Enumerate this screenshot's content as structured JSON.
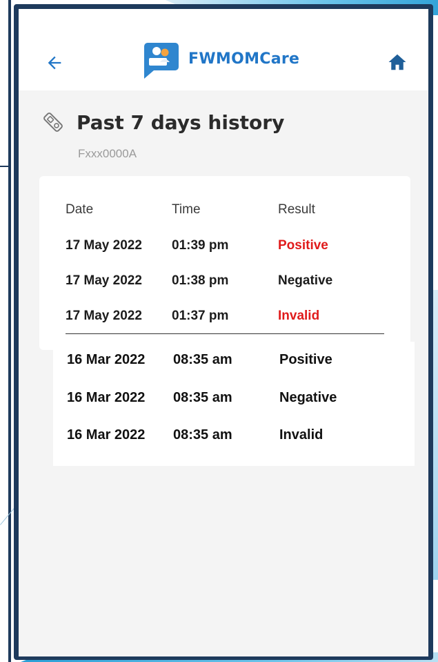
{
  "header": {
    "brand_name": "FWMOMCare",
    "brand_color": "#2176c7"
  },
  "history": {
    "title": "Past 7 days history",
    "patient_id": "Fxxx0000A",
    "columns": [
      "Date",
      "Time",
      "Result"
    ],
    "recent_rows": [
      {
        "date": "17 May 2022",
        "time": "01:39 pm",
        "result": "Positive"
      },
      {
        "date": "17 May 2022",
        "time": "01:38 pm",
        "result": "Negative"
      },
      {
        "date": "17 May 2022",
        "time": "01:37 pm",
        "result": "Invalid"
      }
    ],
    "older_rows": [
      {
        "date": "16 Mar 2022",
        "time": "08:35 am",
        "result": "Positive"
      },
      {
        "date": "16 Mar 2022",
        "time": "08:35 am",
        "result": "Negative"
      },
      {
        "date": "16 Mar 2022",
        "time": "08:35 am",
        "result": "Invalid"
      }
    ]
  },
  "colors": {
    "frame": "#1e3a5c",
    "result_alert": "#e01b1b",
    "accent": "#2176c7"
  },
  "icons": {
    "back": "arrow-left-icon",
    "home": "home-icon",
    "test_kit": "test-kit-icon",
    "logo": "fwmomcare-logo"
  }
}
